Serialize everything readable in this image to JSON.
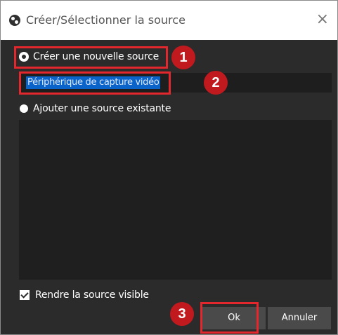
{
  "window": {
    "title": "Créer/Sélectionner la source",
    "close_glyph": "×"
  },
  "options": {
    "create_new_label": "Créer une nouvelle source",
    "name_value": "Périphérique de capture vidéo",
    "add_existing_label": "Ajouter une source existante",
    "selected": "create_new"
  },
  "visibility": {
    "label": "Rendre la source visible",
    "checked": true
  },
  "buttons": {
    "ok_label": "Ok",
    "cancel_label": "Annuler"
  },
  "annotations": {
    "step1": "1",
    "step2": "2",
    "step3": "3",
    "highlight_color": "#e4262d",
    "badge_color": "#c01a1f"
  },
  "colors": {
    "dialog_background": "#2b2b2b",
    "input_background": "#1e1e1e",
    "selection_color": "#0a63c9"
  }
}
